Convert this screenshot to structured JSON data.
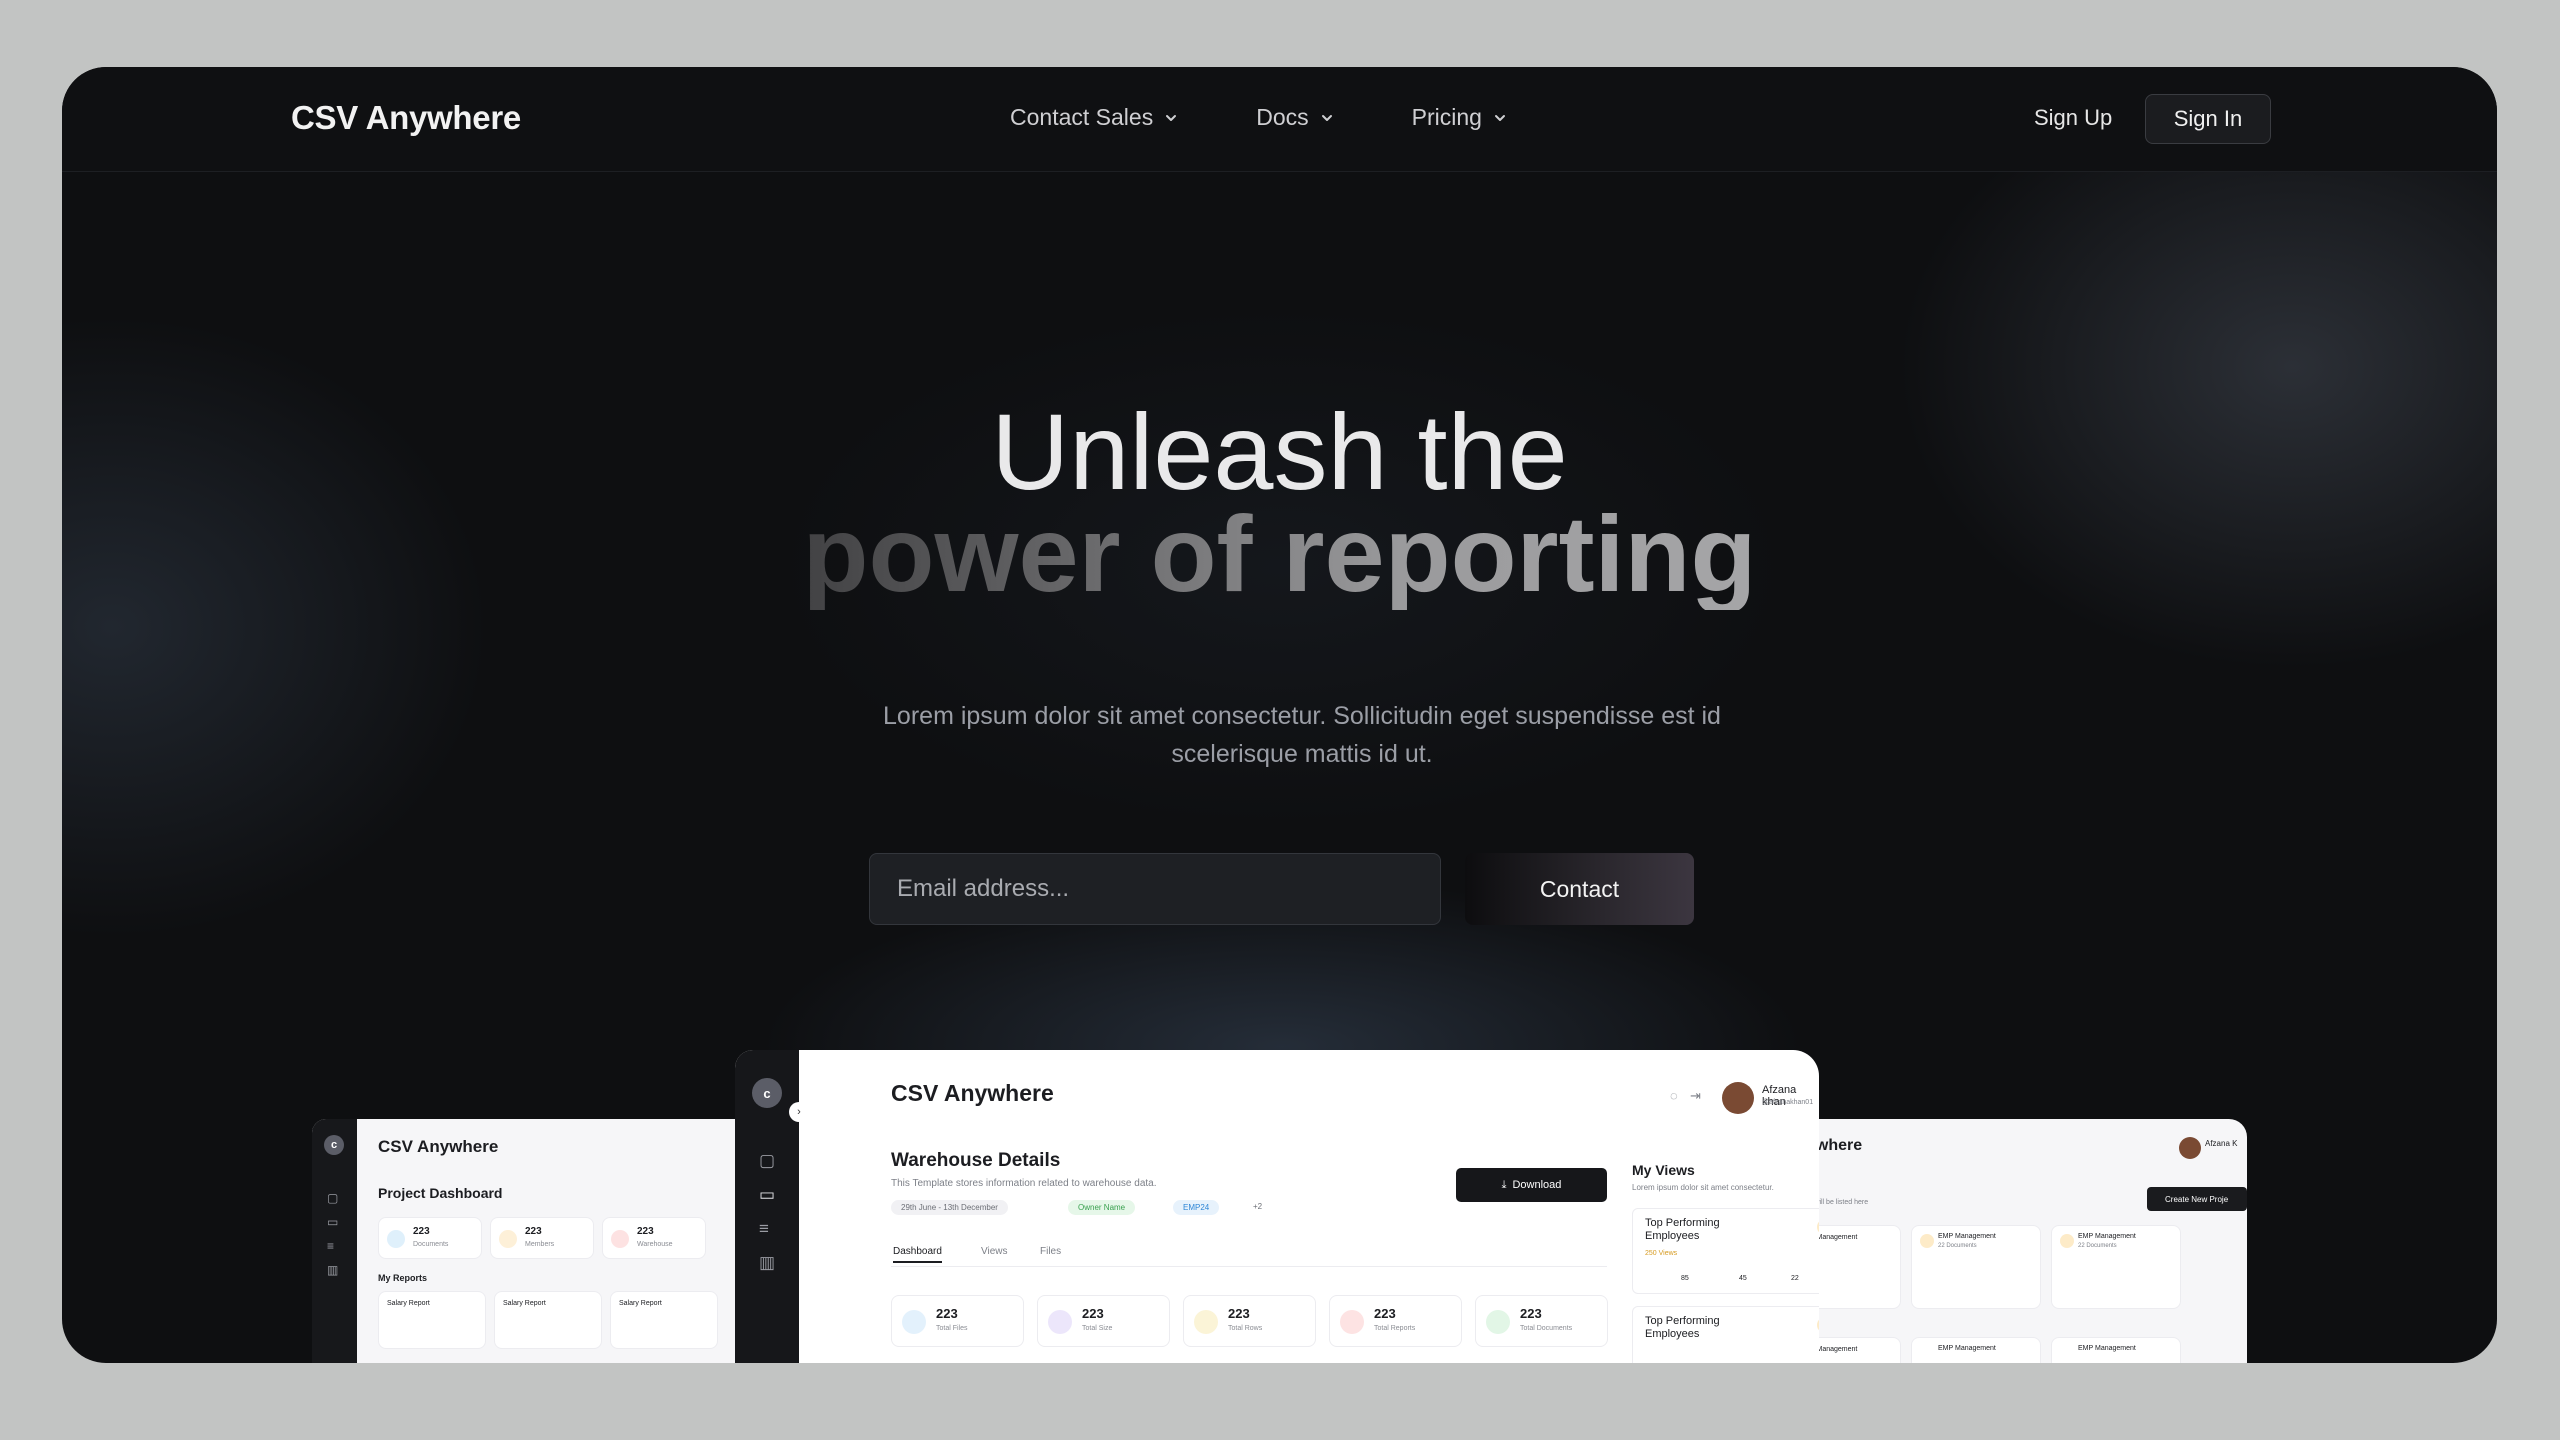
{
  "nav": {
    "logo": "CSV Anywhere",
    "menu": [
      {
        "label": "Contact Sales"
      },
      {
        "label": "Docs"
      },
      {
        "label": "Pricing"
      }
    ],
    "sign_up": "Sign Up",
    "sign_in": "Sign In"
  },
  "hero": {
    "line1": "Unleash the",
    "line2": "power of reporting",
    "subtitle": "Lorem ipsum dolor sit amet consectetur. Sollicitudin eget suspendisse est id scelerisque mattis id ut.",
    "email_placeholder": "Email address...",
    "contact_button": "Contact"
  },
  "preview_main": {
    "avatar_letter": "c",
    "app_title": "CSV Anywhere",
    "user_name": "Afzana khan",
    "user_handle": "@afzanakhan01",
    "section_title": "Warehouse Details",
    "section_desc": "This Template stores information related to warehouse data.",
    "tags": [
      "29th June - 13th December",
      "Owner Name",
      "EMP24",
      "+2"
    ],
    "download": "Download",
    "tabs": [
      "Dashboard",
      "Views",
      "Files"
    ],
    "stats": [
      {
        "value": "223",
        "label": "Total Files"
      },
      {
        "value": "223",
        "label": "Total Size"
      },
      {
        "value": "223",
        "label": "Total Rows"
      },
      {
        "value": "223",
        "label": "Total Reports"
      },
      {
        "value": "223",
        "label": "Total Documents"
      }
    ],
    "views_title": "My Views",
    "views_desc": "Lorem ipsum dolor sit amet consectetur.",
    "view_cards": [
      {
        "title": "Top Performing Employees",
        "meta": "250 Views",
        "stats": [
          "85",
          "45",
          "22"
        ]
      },
      {
        "title": "Top Performing Employees",
        "meta": "",
        "stats": []
      }
    ]
  },
  "preview_left": {
    "avatar_letter": "c",
    "app_title": "CSV Anywhere",
    "section_title": "Project Dashboard",
    "stats": [
      {
        "value": "223",
        "label": "Documents"
      },
      {
        "value": "223",
        "label": "Members"
      },
      {
        "value": "223",
        "label": "Warehouse"
      }
    ],
    "reports_title": "My Reports",
    "reports": [
      "Salary Report",
      "Salary Report",
      "Salary Report"
    ]
  },
  "preview_right": {
    "app_title": "ywhere",
    "subtitle": "ts will be listed here",
    "user_name": "Afzana K",
    "create_button": "Create New Proje",
    "cards": [
      "P Management",
      "EMP Management",
      "EMP Management"
    ],
    "cards2": [
      "P Management",
      "EMP Management",
      "EMP Management"
    ],
    "card_meta": "22 Documents"
  }
}
